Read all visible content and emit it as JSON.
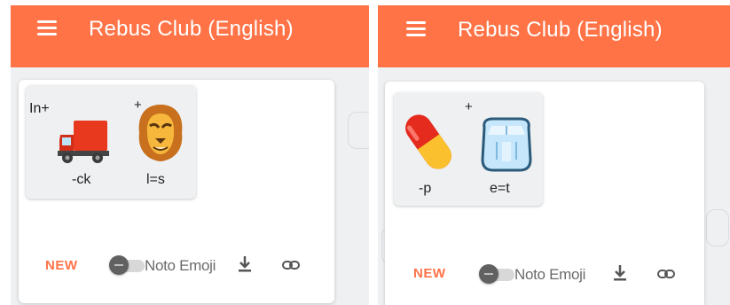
{
  "screens": [
    {
      "title": "Rebus Club (English)",
      "puzzle": {
        "prefix": "In+",
        "plus": "+",
        "parts": [
          {
            "emoji": "truck-emoji",
            "hint": "-ck"
          },
          {
            "emoji": "lion-face-emoji",
            "hint": "l=s"
          }
        ]
      },
      "footer": {
        "new_label": "NEW",
        "toggle_label": "Noto Emoji"
      }
    },
    {
      "title": "Rebus Club (English)",
      "puzzle": {
        "prefix": "",
        "plus": "+",
        "parts": [
          {
            "emoji": "pill-emoji",
            "hint": "-p"
          },
          {
            "emoji": "ice-cube-emoji",
            "hint": "e=t"
          }
        ]
      },
      "footer": {
        "new_label": "NEW",
        "toggle_label": "Noto Emoji"
      }
    }
  ],
  "colors": {
    "accent": "#ff7347",
    "background": "#eef0f2",
    "card": "#ffffff",
    "muted_text": "#6b6b6b"
  },
  "icons": [
    "menu-icon",
    "download-icon",
    "link-icon"
  ]
}
